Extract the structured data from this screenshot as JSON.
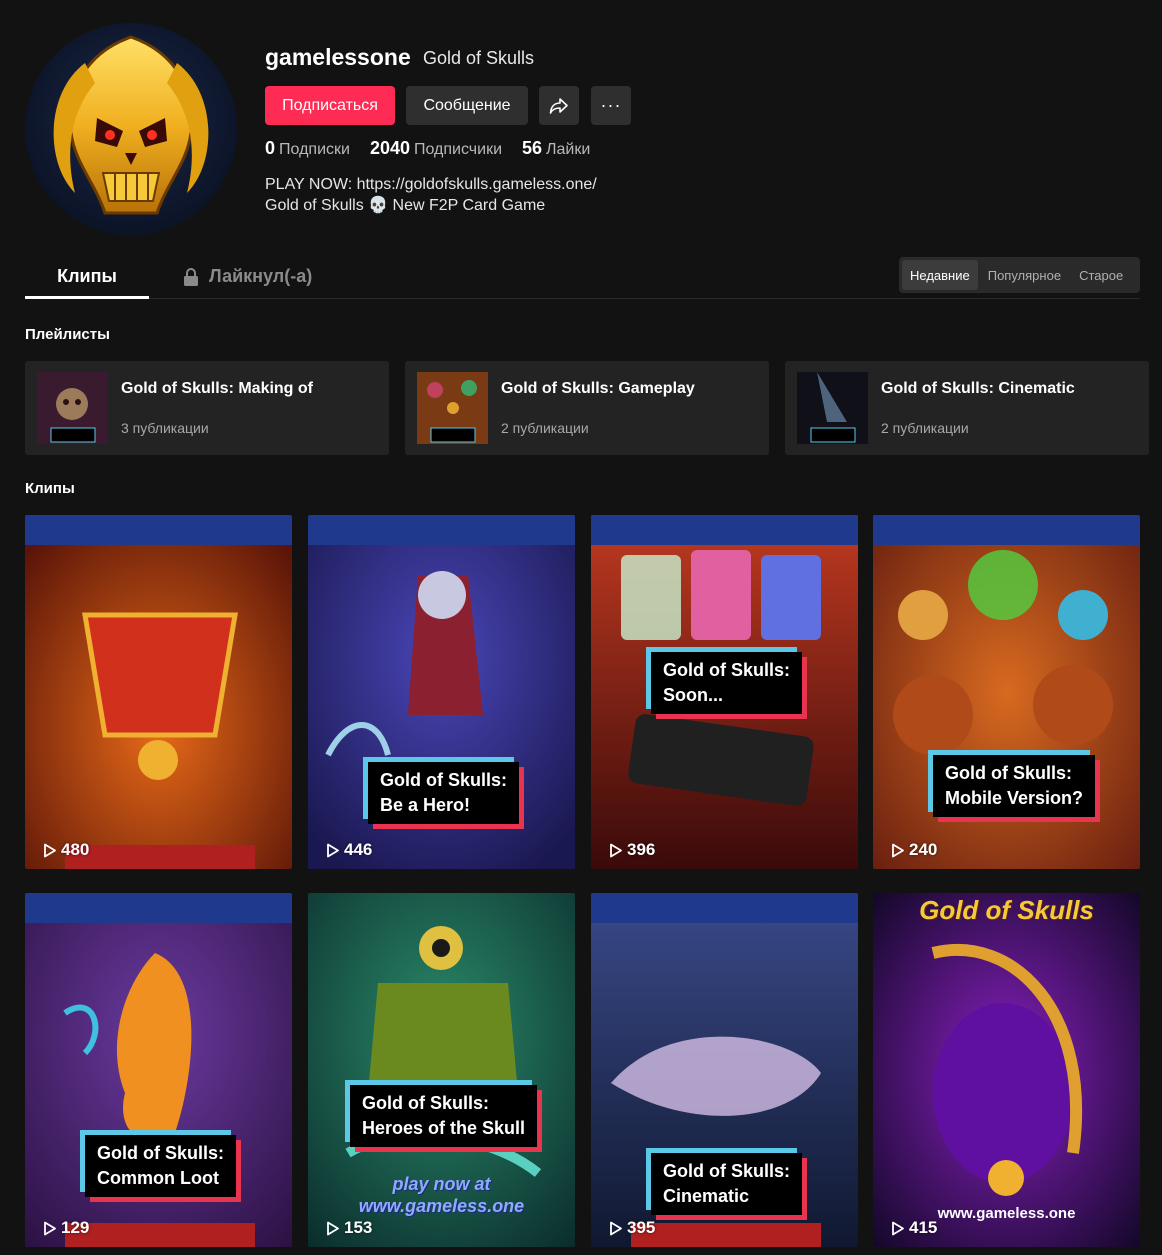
{
  "profile": {
    "username": "gamelessone",
    "nickname": "Gold of Skulls",
    "subscribe_label": "Подписаться",
    "message_label": "Сообщение",
    "share_icon": "share-icon",
    "more_icon": "more-icon",
    "more_label": "···",
    "stats": [
      {
        "value": "0",
        "label": "Подписки"
      },
      {
        "value": "2040",
        "label": "Подписчики"
      },
      {
        "value": "56",
        "label": "Лайки"
      }
    ],
    "bio_line1": "PLAY NOW: https://goldofskulls.gameless.one/",
    "bio_line2": "Gold of Skulls 💀 New F2P Card Game"
  },
  "tabs": {
    "clips": "Клипы",
    "liked": "Лайкнул(-а)"
  },
  "sort": {
    "options": [
      "Недавние",
      "Популярное",
      "Старое"
    ],
    "selected": "Недавние"
  },
  "playlists_title": "Плейлисты",
  "playlists": [
    {
      "title": "Gold of Skulls: Making of",
      "count": "3 публикации",
      "thumb_caption": "Gold of Skulls: Making of..."
    },
    {
      "title": "Gold of Skulls: Gameplay",
      "count": "2 публикации",
      "thumb_caption": "Gold of Skulls: Gameplay"
    },
    {
      "title": "Gold of Skulls: Cinematic",
      "count": "2 публикации",
      "thumb_caption": "Gold of Skulls: Cinematic Part 2"
    }
  ],
  "clips_title": "Клипы",
  "clips": [
    {
      "views": "480",
      "caption": ""
    },
    {
      "views": "446",
      "caption": "Gold of Skulls:\nBe a Hero!"
    },
    {
      "views": "396",
      "caption": "Gold of Skulls:\nSoon..."
    },
    {
      "views": "240",
      "caption": "Gold of Skulls:\nMobile Version?"
    },
    {
      "views": "129",
      "caption": "Gold of Skulls:\nCommon Loot"
    },
    {
      "views": "153",
      "caption": "Gold of Skulls:\nHeroes of the Skull",
      "overlay": "play now at\nwww.gameless.one"
    },
    {
      "views": "395",
      "caption": "Gold of Skulls:\nCinematic"
    },
    {
      "views": "415",
      "caption": "",
      "top_text": "Gold of Skulls",
      "overlay": "www.gameless.one"
    }
  ],
  "colors": {
    "accent": "#fe2c55",
    "background": "#121212",
    "card": "#232323"
  }
}
